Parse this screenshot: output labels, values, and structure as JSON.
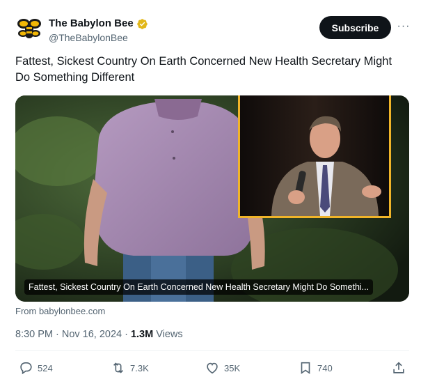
{
  "account": {
    "display_name": "The Babylon Bee",
    "handle": "@TheBabylonBee",
    "subscribe_label": "Subscribe",
    "more_label": "···"
  },
  "tweet": {
    "text": "Fattest, Sickest Country On Earth Concerned New Health Secretary Might Do Something Different"
  },
  "card": {
    "caption": "Fattest, Sickest Country On Earth Concerned New Health Secretary Might Do Somethi...",
    "source": "From babylonbee.com"
  },
  "meta": {
    "time": "8:30 PM",
    "separator": "·",
    "date": "Nov 16, 2024",
    "views_count": "1.3M",
    "views_label": "Views"
  },
  "actions": {
    "replies": "524",
    "reposts": "7.3K",
    "likes": "35K",
    "bookmarks": "740"
  },
  "colors": {
    "text": "#0f1419",
    "secondary": "#536471",
    "verified_gold": "#e2b719",
    "inset_border": "#f0b429"
  }
}
